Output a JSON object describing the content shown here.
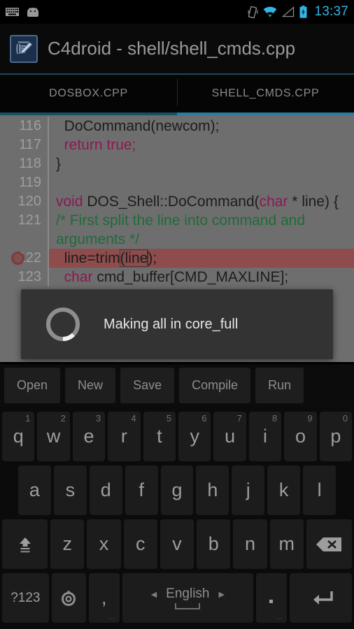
{
  "statusbar": {
    "time": "13:37",
    "left_icons": [
      "keyboard-icon",
      "android-head-icon"
    ],
    "right_icons": [
      "vibrate-icon",
      "wifi-icon",
      "signal-icon",
      "battery-charging-icon"
    ],
    "accent_color": "#33b5e5"
  },
  "titlebar": {
    "title": "C4droid - shell/shell_cmds.cpp",
    "icon": "c4droid-app-icon",
    "rule_color": "#1d4a5c"
  },
  "tabs": [
    {
      "label": "DOSBOX.CPP",
      "active": false
    },
    {
      "label": "SHELL_CMDS.CPP",
      "active": true
    }
  ],
  "editor": {
    "background": "#6e6e6e",
    "keyword_color": "#8a1a52",
    "comment_color": "#1f6b3a",
    "highlight_color": "#8e4c4c",
    "lines": [
      {
        "num": "116",
        "breakpoint": false,
        "highlight": false,
        "parts": [
          {
            "t": "  DoCommand(newcom);",
            "c": ""
          }
        ]
      },
      {
        "num": "117",
        "breakpoint": false,
        "highlight": false,
        "parts": [
          {
            "t": "  ",
            "c": ""
          },
          {
            "t": "return true;",
            "c": "kw"
          }
        ]
      },
      {
        "num": "118",
        "breakpoint": false,
        "highlight": false,
        "parts": [
          {
            "t": "}",
            "c": ""
          }
        ]
      },
      {
        "num": "119",
        "breakpoint": false,
        "highlight": false,
        "parts": [
          {
            "t": "",
            "c": ""
          }
        ]
      },
      {
        "num": "120",
        "breakpoint": false,
        "highlight": false,
        "parts": [
          {
            "t": "void",
            "c": "kw"
          },
          {
            "t": " DOS_Shell::DoCommand(",
            "c": ""
          },
          {
            "t": "char",
            "c": "kw"
          },
          {
            "t": " * line) {",
            "c": ""
          }
        ]
      },
      {
        "num": "121",
        "breakpoint": false,
        "highlight": false,
        "parts": [
          {
            "t": "/* First split the line into command and arguments */",
            "c": "cmt"
          }
        ]
      },
      {
        "num": "122",
        "breakpoint": true,
        "highlight": true,
        "parts": [
          {
            "t": "  line=trim(line);",
            "c": ""
          }
        ]
      },
      {
        "num": "123",
        "breakpoint": false,
        "highlight": false,
        "parts": [
          {
            "t": "  ",
            "c": ""
          },
          {
            "t": "char",
            "c": "kw"
          },
          {
            "t": " cmd_buffer[CMD_MAXLINE];",
            "c": ""
          }
        ]
      }
    ]
  },
  "dialog": {
    "message": "Making all in core_full",
    "spinner": "progress-spinner",
    "background": "#333333"
  },
  "toolbar": {
    "buttons": [
      {
        "label": "Open"
      },
      {
        "label": "New"
      },
      {
        "label": "Save"
      },
      {
        "label": "Compile"
      },
      {
        "label": "Run"
      }
    ]
  },
  "keyboard": {
    "row1": [
      {
        "key": "q",
        "hint": "1"
      },
      {
        "key": "w",
        "hint": "2"
      },
      {
        "key": "e",
        "hint": "3"
      },
      {
        "key": "r",
        "hint": "4"
      },
      {
        "key": "t",
        "hint": "5"
      },
      {
        "key": "y",
        "hint": "6"
      },
      {
        "key": "u",
        "hint": "7"
      },
      {
        "key": "i",
        "hint": "8"
      },
      {
        "key": "o",
        "hint": "9"
      },
      {
        "key": "p",
        "hint": "0"
      }
    ],
    "row2": [
      {
        "key": "a"
      },
      {
        "key": "s"
      },
      {
        "key": "d"
      },
      {
        "key": "f"
      },
      {
        "key": "g"
      },
      {
        "key": "h"
      },
      {
        "key": "j"
      },
      {
        "key": "k"
      },
      {
        "key": "l"
      }
    ],
    "row3": [
      {
        "key": "z"
      },
      {
        "key": "x"
      },
      {
        "key": "c"
      },
      {
        "key": "v"
      },
      {
        "key": "b"
      },
      {
        "key": "n"
      },
      {
        "key": "m"
      }
    ],
    "shift_key": "shift-key",
    "backspace_key": "backspace-key",
    "symbols_label": "?123",
    "mic_key": "voice-input-key",
    "comma_label": ",",
    "space_label": "English",
    "space_left_arrow": "◀",
    "space_right_arrow": "▶",
    "period_label": ".",
    "enter_key": "enter-key",
    "dots": "..."
  }
}
